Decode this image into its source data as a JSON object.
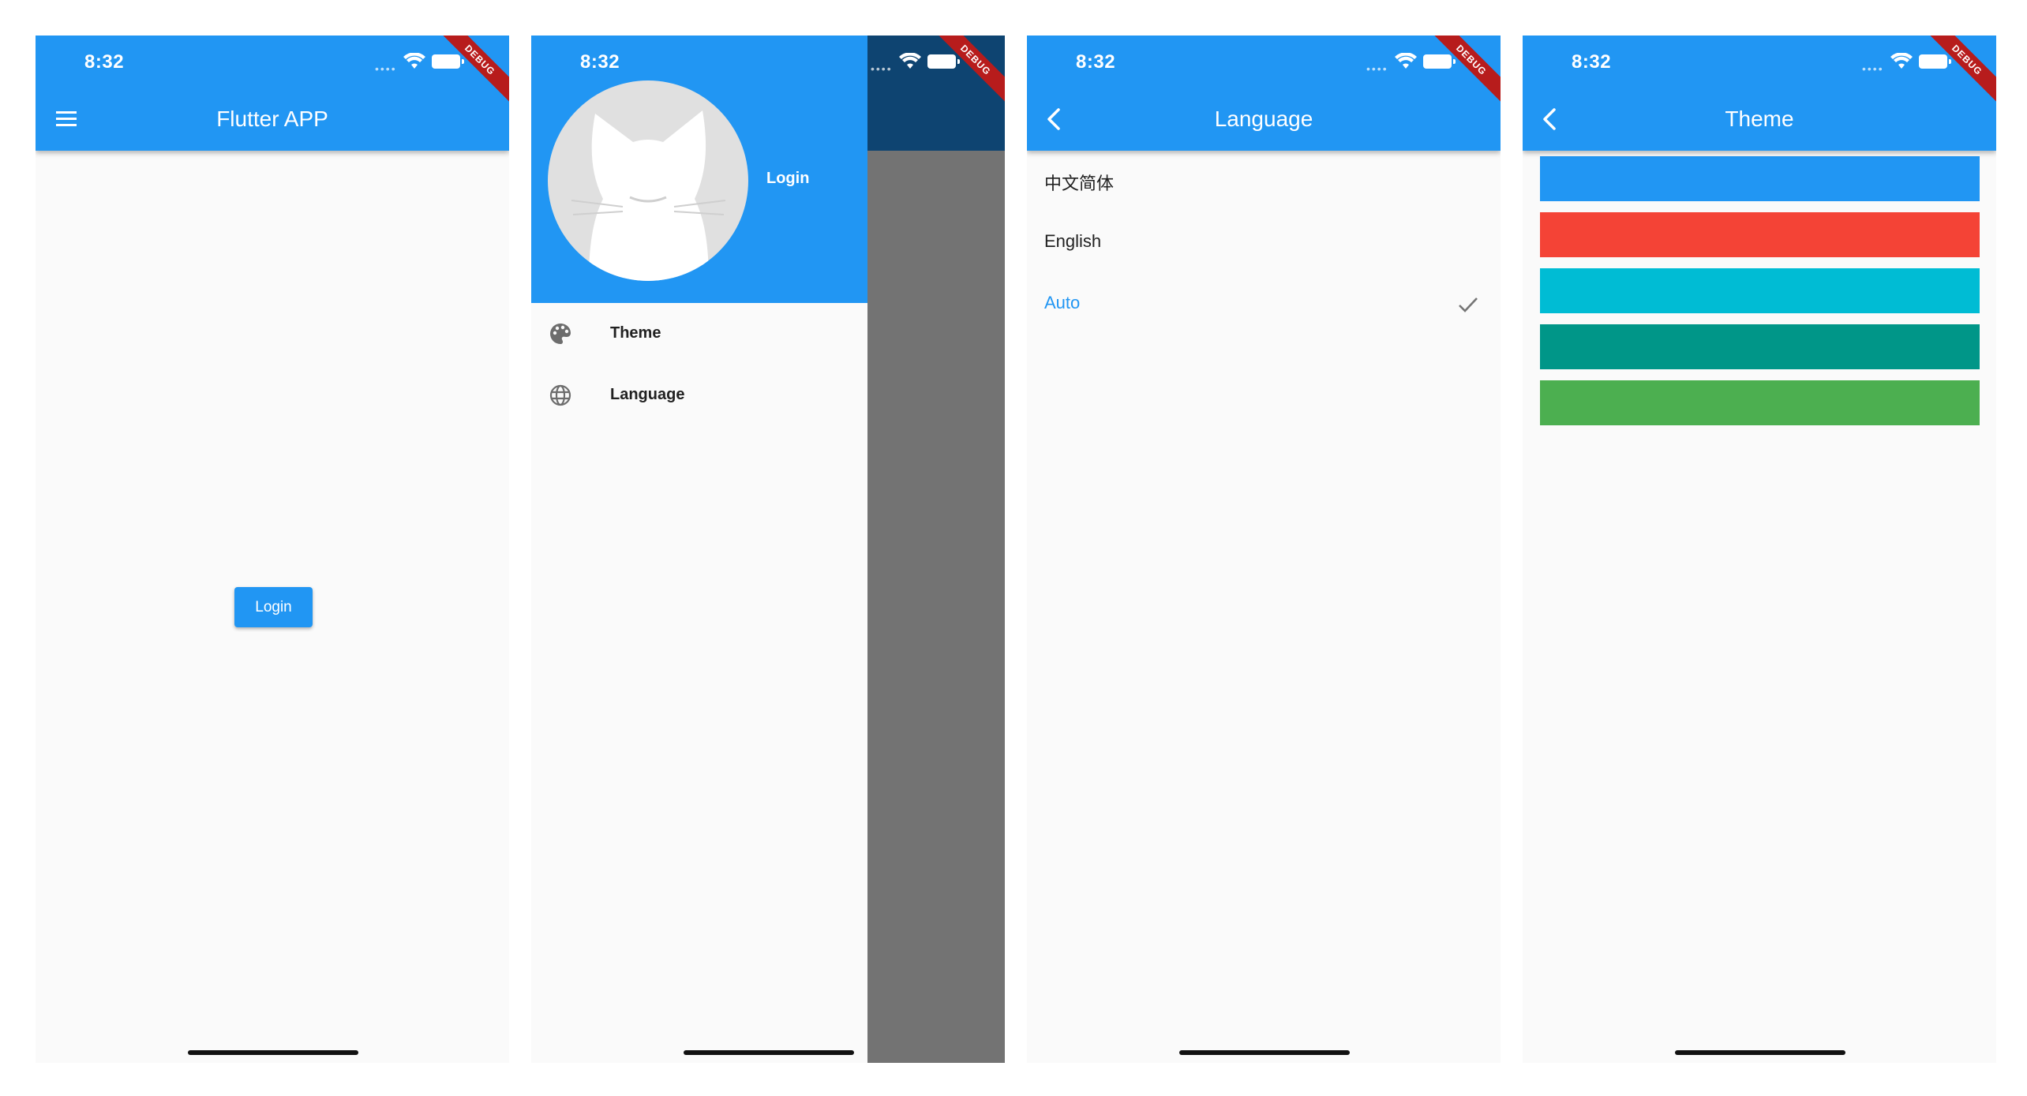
{
  "status": {
    "time": "8:32",
    "debug_banner": "DEBUG"
  },
  "home": {
    "title": "Flutter APP",
    "login_button": "Login"
  },
  "drawer": {
    "login_label": "Login",
    "items": [
      {
        "label": "Theme",
        "icon": "palette-icon"
      },
      {
        "label": "Language",
        "icon": "globe-icon"
      }
    ]
  },
  "language": {
    "title": "Language",
    "options": [
      {
        "label": "中文简体",
        "selected": false
      },
      {
        "label": "English",
        "selected": false
      },
      {
        "label": "Auto",
        "selected": true
      }
    ]
  },
  "theme": {
    "title": "Theme",
    "colors": [
      "#2196f3",
      "#f44336",
      "#00bcd4",
      "#009688",
      "#4caf50"
    ]
  },
  "colors": {
    "primary": "#2196f3",
    "background": "#fafafa",
    "scrim": "#737373"
  }
}
